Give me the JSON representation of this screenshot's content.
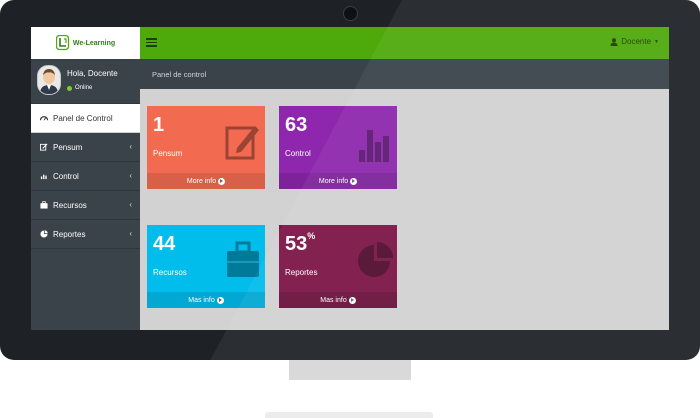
{
  "app": {
    "logo_text": "We-Learning"
  },
  "topbar": {
    "user_label": "Docente"
  },
  "sidebar": {
    "greeting": "Hola, Docente",
    "status": "Online",
    "items": [
      {
        "label": "Panel de Control",
        "icon": "dashboard-icon"
      },
      {
        "label": "Pensum",
        "icon": "edit-icon"
      },
      {
        "label": "Control",
        "icon": "chart-icon"
      },
      {
        "label": "Recursos",
        "icon": "briefcase-icon"
      },
      {
        "label": "Reportes",
        "icon": "pie-chart-icon"
      }
    ]
  },
  "content": {
    "header_title": "Panel de control"
  },
  "boxes": [
    {
      "value": "1",
      "label": "Pensum",
      "footer": "More info",
      "color": "#f26a50",
      "footer_color": "#d85f48",
      "icon": "edit-icon"
    },
    {
      "value": "63",
      "label": "Control",
      "footer": "More info",
      "color": "#8e27ad",
      "footer_color": "#7d229a",
      "icon": "bar-chart-icon"
    },
    {
      "value": "44",
      "label": "Recursos",
      "footer": "Mas info",
      "color": "#00bdec",
      "footer_color": "#00a8d3",
      "icon": "briefcase-icon"
    },
    {
      "value": "53",
      "suffix": "%",
      "label": "Reportes",
      "footer": "Mas info",
      "color": "#7c1446",
      "footer_color": "#6b103c",
      "icon": "pie-chart-icon"
    }
  ],
  "colors": {
    "topbar": "#4ea90a",
    "sidebar": "#3a424a",
    "content_bg": "#d2d2d2"
  }
}
